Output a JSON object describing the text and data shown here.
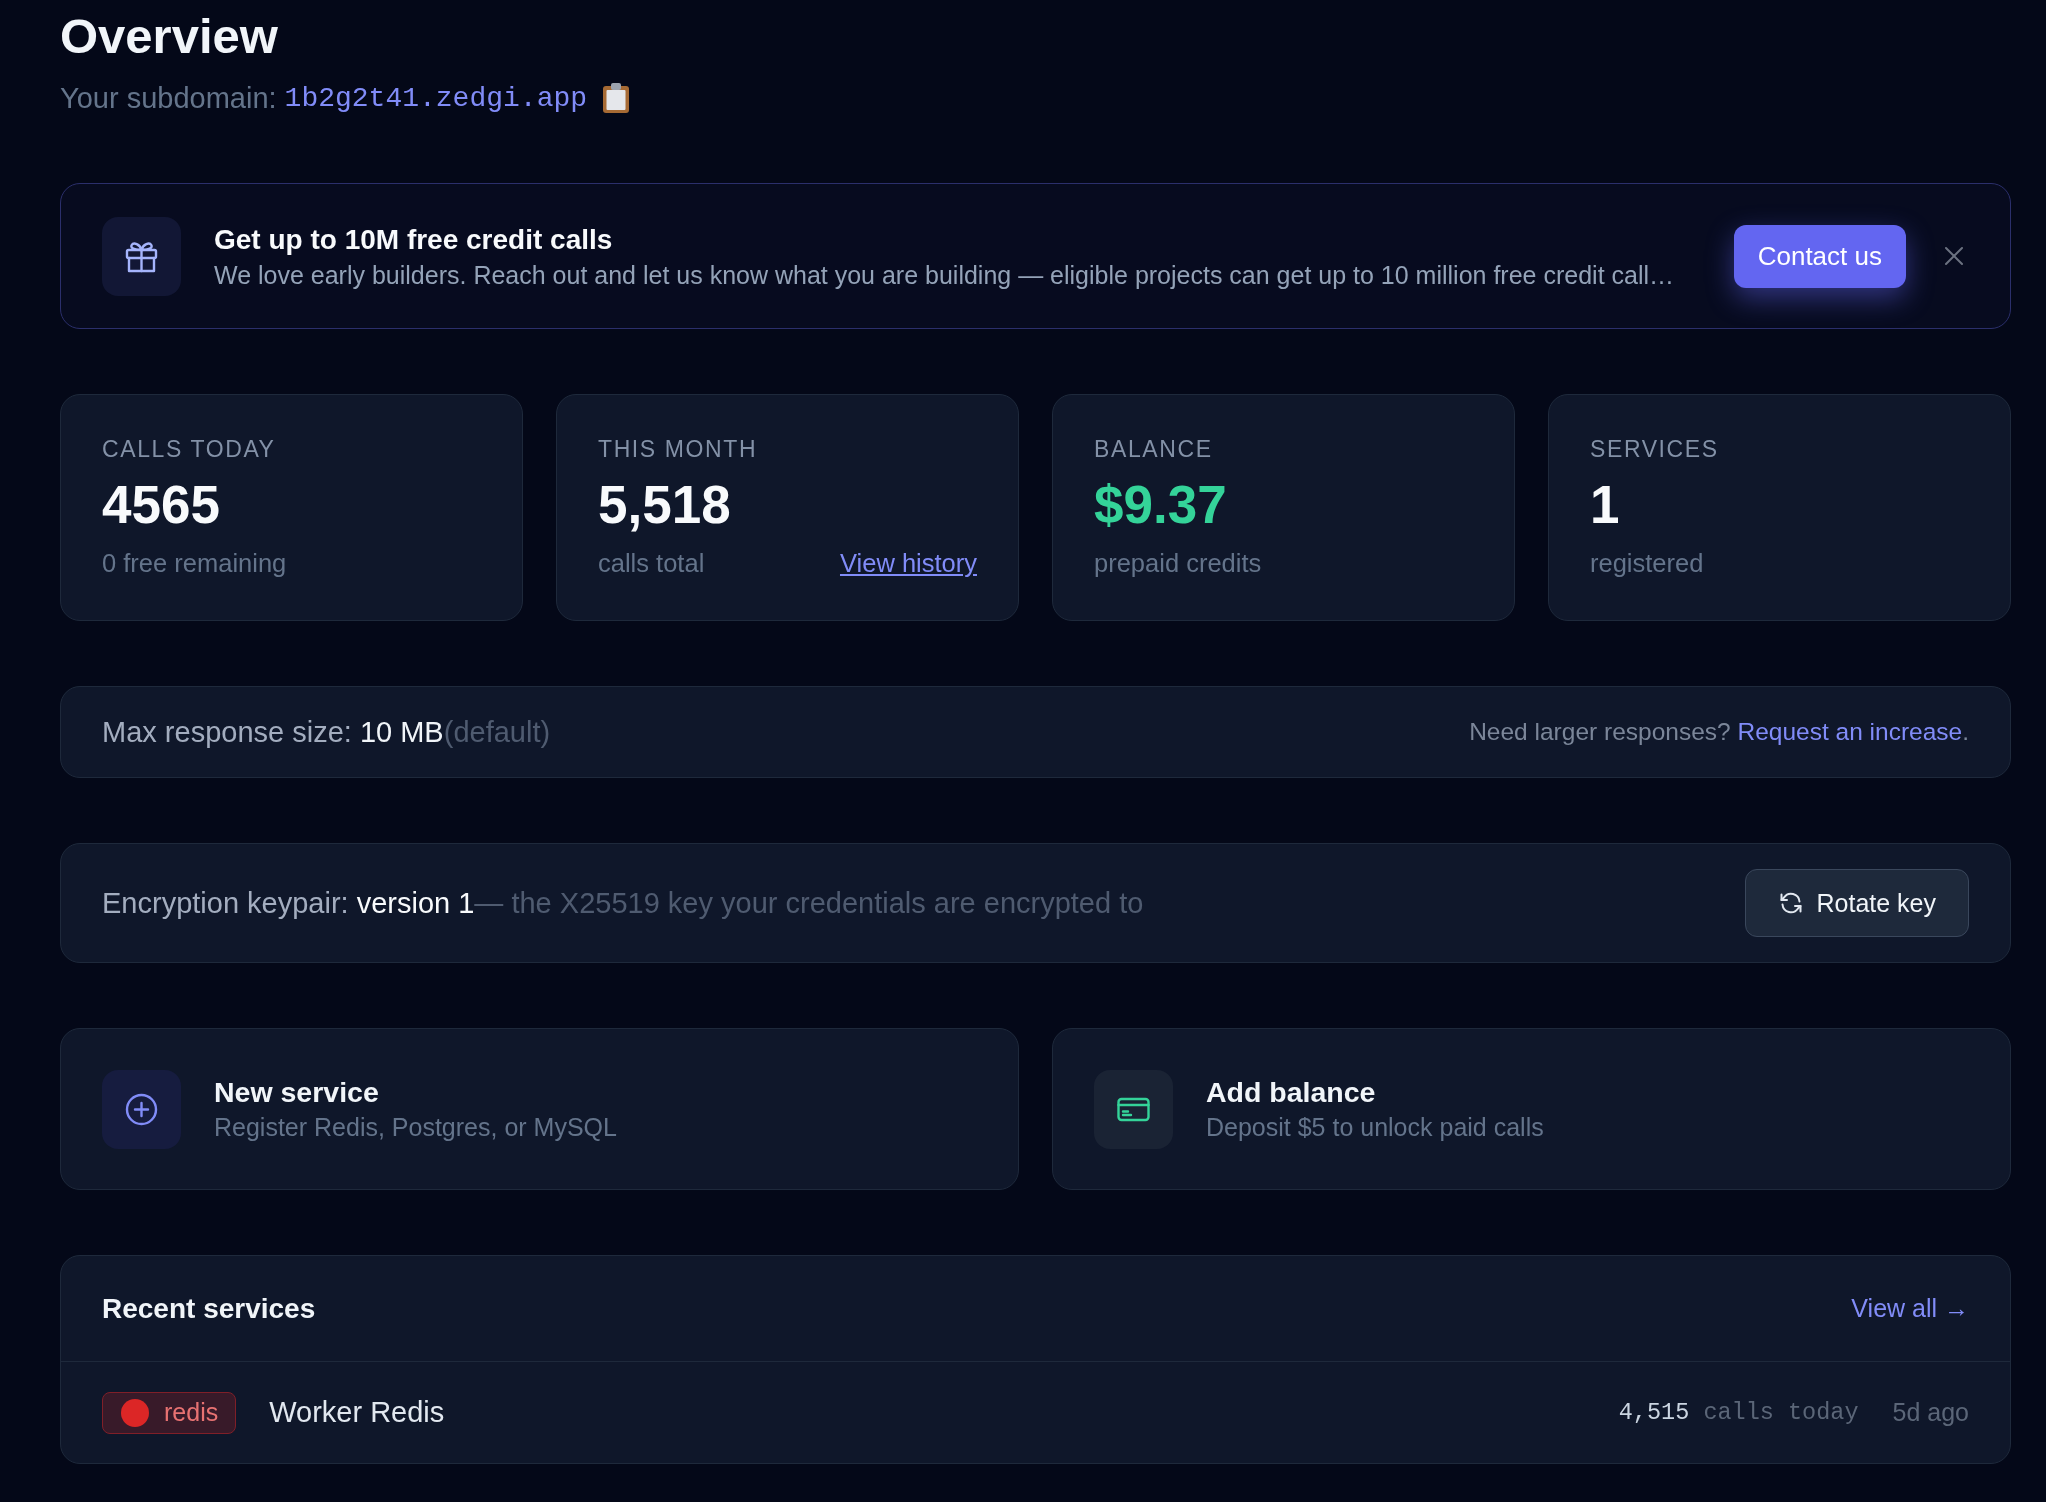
{
  "page": {
    "title": "Overview",
    "subdomain_label": "Your subdomain:",
    "subdomain": "1b2g2t41.zedgi.app"
  },
  "banner": {
    "title": "Get up to 10M free credit calls",
    "text": "We love early builders. Reach out and let us know what you are building — eligible projects can get up to 10 million free credit call…",
    "button": "Contact us"
  },
  "stats": [
    {
      "label": "CALLS TODAY",
      "value": "4565",
      "caption": "0 free remaining",
      "highlight": false
    },
    {
      "label": "THIS MONTH",
      "value": "5,518",
      "caption": "calls total",
      "link": "View history",
      "highlight": false
    },
    {
      "label": "BALANCE",
      "value": "$9.37",
      "caption": "prepaid credits",
      "highlight": true
    },
    {
      "label": "SERVICES",
      "value": "1",
      "caption": "registered",
      "highlight": false
    }
  ],
  "response_limit": {
    "label": "Max response size:",
    "value": "10 MB",
    "note": "(default)",
    "prompt": "Need larger responses?",
    "link": "Request an increase",
    "suffix": "."
  },
  "keypair": {
    "label": "Encryption keypair:",
    "version": "version 1",
    "note": "— the X25519 key your credentials are encrypted to",
    "button": "Rotate key"
  },
  "actions": [
    {
      "kind": "add",
      "title": "New service",
      "description": "Register Redis, Postgres, or MySQL"
    },
    {
      "kind": "card",
      "title": "Add balance",
      "description": "Deposit $5 to unlock paid calls"
    }
  ],
  "recent": {
    "title": "Recent services",
    "link": "View all →",
    "services": [
      {
        "type": "redis",
        "color": "#dc2626",
        "name": "Worker Redis",
        "calls": "4,515",
        "calls_label": "calls today",
        "age": "5d ago"
      }
    ]
  }
}
